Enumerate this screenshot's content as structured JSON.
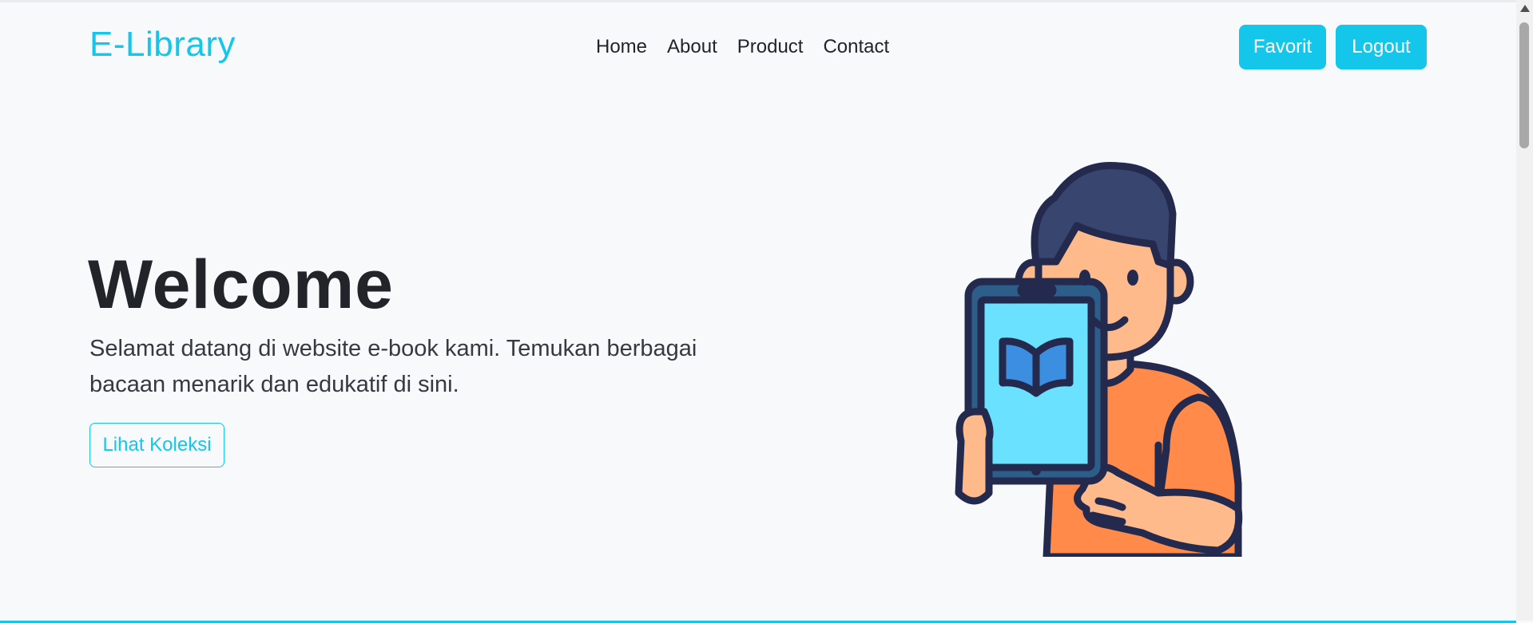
{
  "header": {
    "brand": "E-Library",
    "nav": [
      "Home",
      "About",
      "Product",
      "Contact"
    ],
    "favorit_label": "Favorit",
    "logout_label": "Logout"
  },
  "hero": {
    "title": "Welcome",
    "subtitle": "Selamat datang di website e-book kami. Temukan berbagai bacaan menarik dan edukatif di sini.",
    "cta_label": "Lihat Koleksi"
  },
  "illustration": {
    "icon": "boy-reading-ebook-on-tablet-illustration"
  },
  "colors": {
    "accent": "#13c6ea",
    "background": "#f8f9fa",
    "text": "#212529"
  }
}
